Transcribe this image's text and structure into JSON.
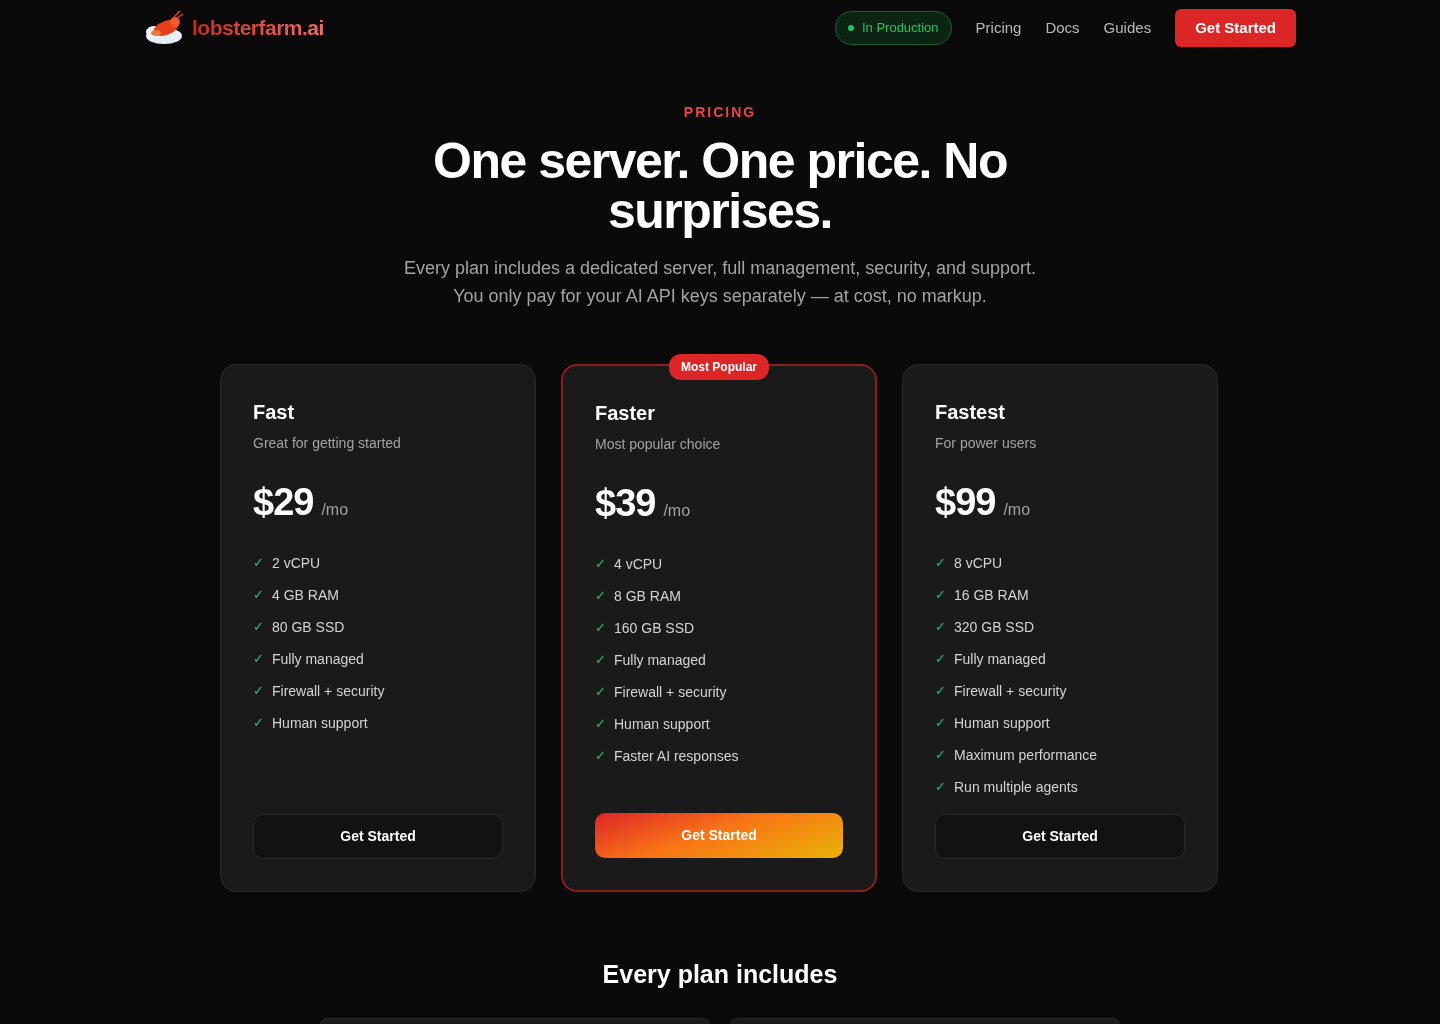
{
  "nav": {
    "logo": "lobsterfarm.ai",
    "status": "In Production",
    "links": [
      "Pricing",
      "Docs",
      "Guides"
    ],
    "cta": "Get Started"
  },
  "hero": {
    "eyebrow": "PRICING",
    "title": "One server. One price. No surprises.",
    "subtitle_lines": [
      "Every plan includes a dedicated server, full management, security, and support.",
      "You only pay for your AI API keys separately — at cost, no markup."
    ]
  },
  "plans": [
    {
      "name": "Fast",
      "tagline": "Great for getting started",
      "price": "$29",
      "period": "/mo",
      "featured": false,
      "features": [
        "2 vCPU",
        "4 GB RAM",
        "80 GB SSD",
        "Fully managed",
        "Firewall + security",
        "Human support"
      ],
      "button": "Get Started"
    },
    {
      "name": "Faster",
      "tagline": "Most popular choice",
      "price": "$39",
      "period": "/mo",
      "featured": true,
      "badge": "Most Popular",
      "features": [
        "4 vCPU",
        "8 GB RAM",
        "160 GB SSD",
        "Fully managed",
        "Firewall + security",
        "Human support",
        "Faster AI responses"
      ],
      "button": "Get Started"
    },
    {
      "name": "Fastest",
      "tagline": "For power users",
      "price": "$99",
      "period": "/mo",
      "featured": false,
      "features": [
        "8 vCPU",
        "16 GB RAM",
        "320 GB SSD",
        "Fully managed",
        "Firewall + security",
        "Human support",
        "Maximum performance",
        "Run multiple agents"
      ],
      "button": "Get Started"
    }
  ],
  "includes": {
    "title": "Every plan includes"
  },
  "check_mark": "✓"
}
